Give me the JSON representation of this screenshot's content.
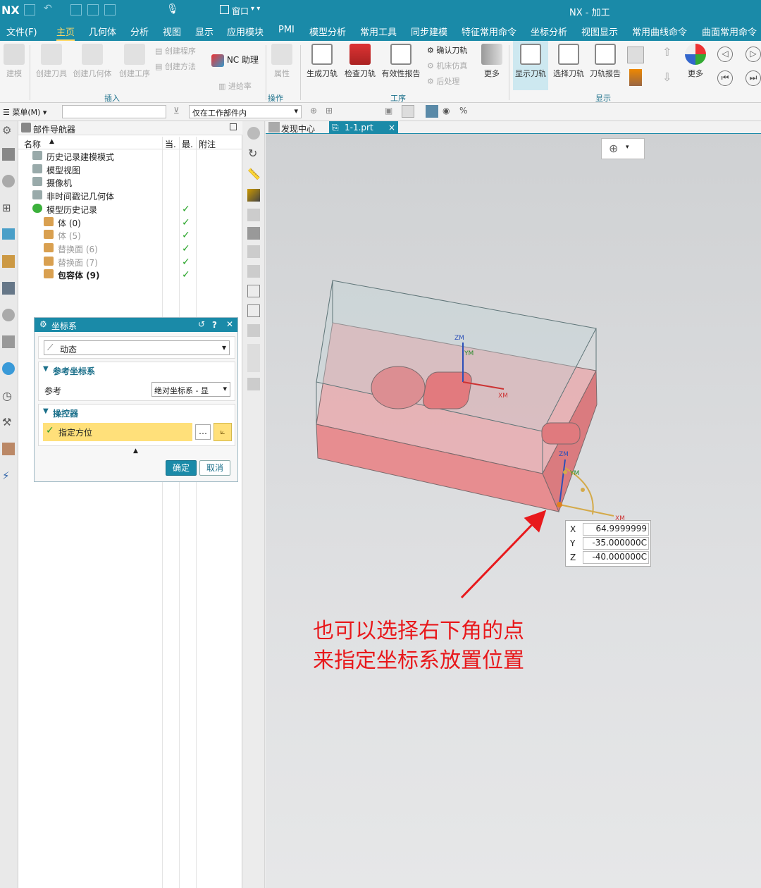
{
  "titlebar": {
    "logo": "NX",
    "window_menu": "窗口",
    "title": "NX - 加工"
  },
  "menubar": {
    "items": [
      "文件(F)",
      "主页",
      "几何体",
      "分析",
      "视图",
      "显示",
      "应用模块",
      "PMI",
      "模型分析",
      "常用工具",
      "同步建模",
      "特征常用命令",
      "坐标分析",
      "视图显示",
      "常用曲线命令",
      "曲面常用命令"
    ]
  },
  "ribbon": {
    "build": "建模",
    "create_tool": "创建刀具",
    "create_geometry": "创建几何体",
    "create_operation": "创建工序",
    "create_program": "创建程序",
    "create_method": "创建方法",
    "nc_assist": "NC 助理",
    "feed_rate": "进给率",
    "attributes": "属性",
    "group_insert": "插入",
    "group_operation": "操作",
    "generate_path": "生成刀轨",
    "verify_path": "检查刀轨",
    "validity_report": "有效性报告",
    "confirm_path": "确认刀轨",
    "machine_sim": "机床仿真",
    "postprocess": "后处理",
    "more": "更多",
    "group_process": "工序",
    "show_path": "显示刀轨",
    "select_path": "选择刀轨",
    "path_report": "刀轨报告",
    "more2": "更多",
    "group_display": "显示"
  },
  "toolbar2": {
    "menu": "菜单(M)",
    "filter_value": "仅在工作部件内"
  },
  "navigator": {
    "title": "部件导航器",
    "col_name": "名称",
    "col_current": "当.",
    "col_latest": "最.",
    "col_note": "附注",
    "rows": [
      {
        "label": "历史记录建模模式",
        "checked": false,
        "dim": false
      },
      {
        "label": "模型视图",
        "checked": false,
        "dim": false
      },
      {
        "label": "摄像机",
        "checked": false,
        "dim": false
      },
      {
        "label": "非时间戳记几何体",
        "checked": false,
        "dim": false
      },
      {
        "label": "模型历史记录",
        "checked": true,
        "dim": false
      },
      {
        "label": "体 (0)",
        "checked": true,
        "dim": false
      },
      {
        "label": "体 (5)",
        "checked": true,
        "dim": true
      },
      {
        "label": "替换面 (6)",
        "checked": true,
        "dim": true
      },
      {
        "label": "替换面 (7)",
        "checked": true,
        "dim": true
      },
      {
        "label": "包容体 (9)",
        "checked": true,
        "dim": false
      }
    ]
  },
  "dialog": {
    "title": "坐标系",
    "type_value": "动态",
    "section_ref": "参考坐标系",
    "ref_label": "参考",
    "ref_value": "绝对坐标系 - 显",
    "section_manip": "操控器",
    "specify_orient": "指定方位",
    "ok": "确定",
    "cancel": "取消"
  },
  "tabs": {
    "discovery": "发现中心",
    "file": "1-1.prt"
  },
  "viewport": {
    "axis_zm": "ZM",
    "axis_ym": "YM",
    "axis_xm": "XM",
    "coord_x_label": "X",
    "coord_x": "64.9999999",
    "coord_y_label": "Y",
    "coord_y": "-35.000000C",
    "coord_z_label": "Z",
    "coord_z": "-40.000000C",
    "annotation_line1": "也可以选择右下角的点",
    "annotation_line2": "来指定坐标系放置位置"
  },
  "colors": {
    "accent": "#1a8aa8",
    "highlight": "#ffe07a",
    "annotation": "#e8191c"
  }
}
